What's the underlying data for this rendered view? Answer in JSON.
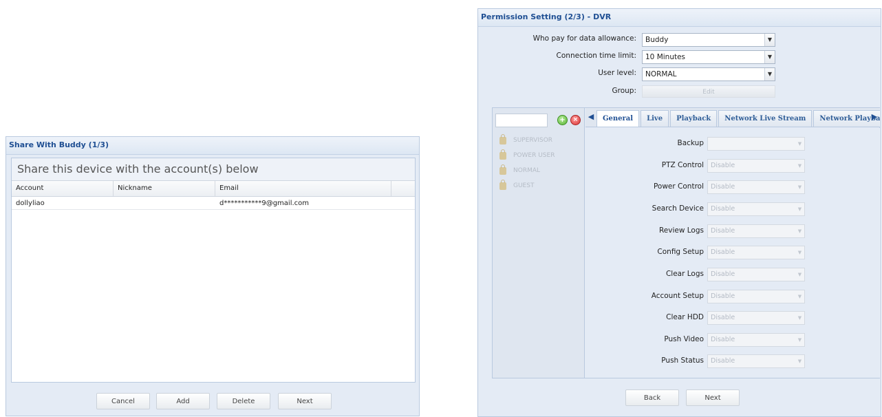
{
  "left_dialog": {
    "title": "Share With Buddy (1/3)",
    "heading": "Share this device with the account(s) below",
    "columns": [
      "Account",
      "Nickname",
      "Email",
      ""
    ],
    "rows": [
      {
        "account": "dollyliao",
        "nickname": "",
        "email": "d***********9@gmail.com"
      }
    ],
    "buttons": {
      "cancel": "Cancel",
      "add": "Add",
      "delete": "Delete",
      "next": "Next"
    }
  },
  "right_dialog": {
    "title": "Permission Setting (2/3) - DVR",
    "fields": {
      "data_allowance": {
        "label": "Who pay for data allowance:",
        "value": "Buddy"
      },
      "time_limit": {
        "label": "Connection time limit:",
        "value": "10 Minutes"
      },
      "user_level": {
        "label": "User level:",
        "value": "NORMAL"
      },
      "group": {
        "label": "Group:",
        "button": "Edit"
      }
    },
    "user_list": [
      "SUPERVISOR",
      "POWER USER",
      "NORMAL",
      "GUEST"
    ],
    "tabs": [
      "General",
      "Live",
      "Playback",
      "Network Live Stream",
      "Network Playback"
    ],
    "active_tab": "General",
    "permissions": [
      {
        "label": "Backup",
        "value": ""
      },
      {
        "label": "PTZ Control",
        "value": "Disable"
      },
      {
        "label": "Power Control",
        "value": "Disable"
      },
      {
        "label": "Search Device",
        "value": "Disable"
      },
      {
        "label": "Review Logs",
        "value": "Disable"
      },
      {
        "label": "Config Setup",
        "value": "Disable"
      },
      {
        "label": "Clear Logs",
        "value": "Disable"
      },
      {
        "label": "Account Setup",
        "value": "Disable"
      },
      {
        "label": "Clear HDD",
        "value": "Disable"
      },
      {
        "label": "Push Video",
        "value": "Disable"
      },
      {
        "label": "Push Status",
        "value": "Disable"
      }
    ],
    "buttons": {
      "back": "Back",
      "next": "Next"
    }
  },
  "icons": {
    "add": "add-circle-icon",
    "delete": "delete-circle-icon",
    "lock": "lock-icon",
    "arrow_left": "arrow-left-icon",
    "arrow_right": "arrow-right-icon",
    "dropdown": "chevron-down-icon"
  },
  "colors": {
    "title": "#1f4f93",
    "panel_bg": "#e4ebf5",
    "border": "#b9c9df"
  }
}
